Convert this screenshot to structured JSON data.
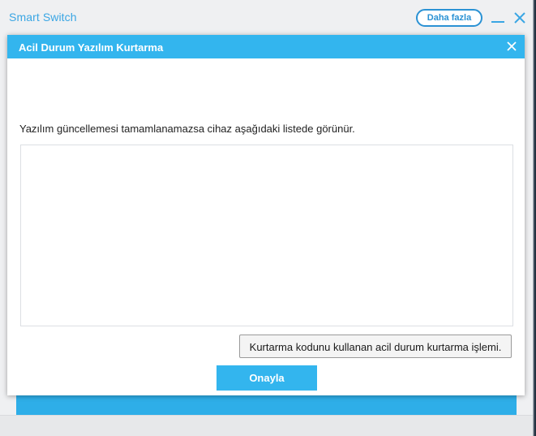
{
  "app": {
    "title": "Smart Switch",
    "more_label": "Daha fazla",
    "minimize_icon": "minimize-icon",
    "close_icon": "close-icon"
  },
  "dialog": {
    "title": "Acil Durum Yazılım Kurtarma",
    "close_icon": "close-icon",
    "message": "Yazılım güncellemesi tamamlanamazsa cihaz aşağıdaki listede görünür.",
    "device_list": [],
    "recovery_code_button_label": "Kurtarma kodunu kullanan acil durum kurtarma işlemi.",
    "confirm_button_label": "Onayla"
  },
  "colors": {
    "accent": "#33b5ee",
    "app_title": "#3aa6e4",
    "more_button_border": "#2a92d4"
  }
}
